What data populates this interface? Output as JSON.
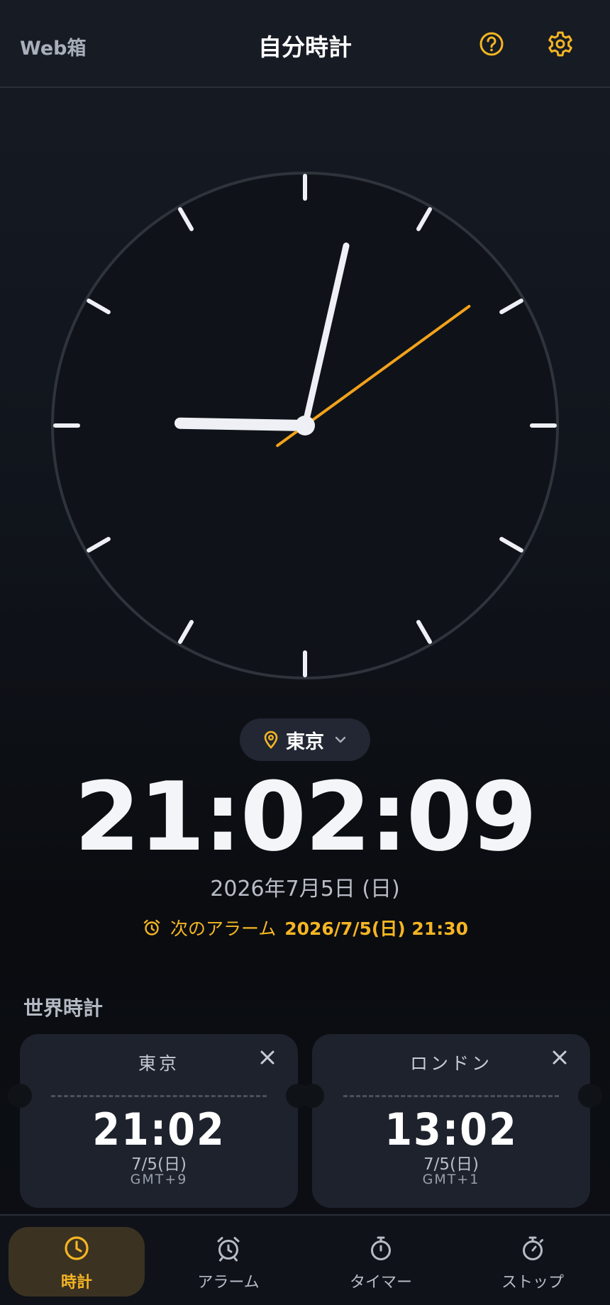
{
  "header": {
    "brand": "Web箱",
    "title": "自分時計"
  },
  "colors": {
    "accent": "#f5b523",
    "second_hand": "#f3a21b",
    "bg": "#10141b",
    "card": "#1d222d"
  },
  "clock": {
    "hour": 21,
    "minute": 2,
    "second": 9,
    "city": "東京",
    "digital_time": "21:02:09",
    "date": "2026年7月5日 (日)"
  },
  "next_alarm": {
    "label": "次のアラーム",
    "value": "2026/7/5(日) 21:30"
  },
  "world_clock": {
    "title": "世界時計",
    "cards": [
      {
        "city": "東京",
        "time": "21:02",
        "date": "7/5(日)",
        "gmt": "GMT+9"
      },
      {
        "city": "ロンドン",
        "time": "13:02",
        "date": "7/5(日)",
        "gmt": "GMT+1"
      }
    ]
  },
  "nav": {
    "items": [
      {
        "label": "時計",
        "icon": "clock-icon",
        "active": true
      },
      {
        "label": "アラーム",
        "icon": "alarm-icon",
        "active": false
      },
      {
        "label": "タイマー",
        "icon": "timer-icon",
        "active": false
      },
      {
        "label": "ストップ",
        "icon": "stopwatch-icon",
        "active": false
      }
    ]
  }
}
